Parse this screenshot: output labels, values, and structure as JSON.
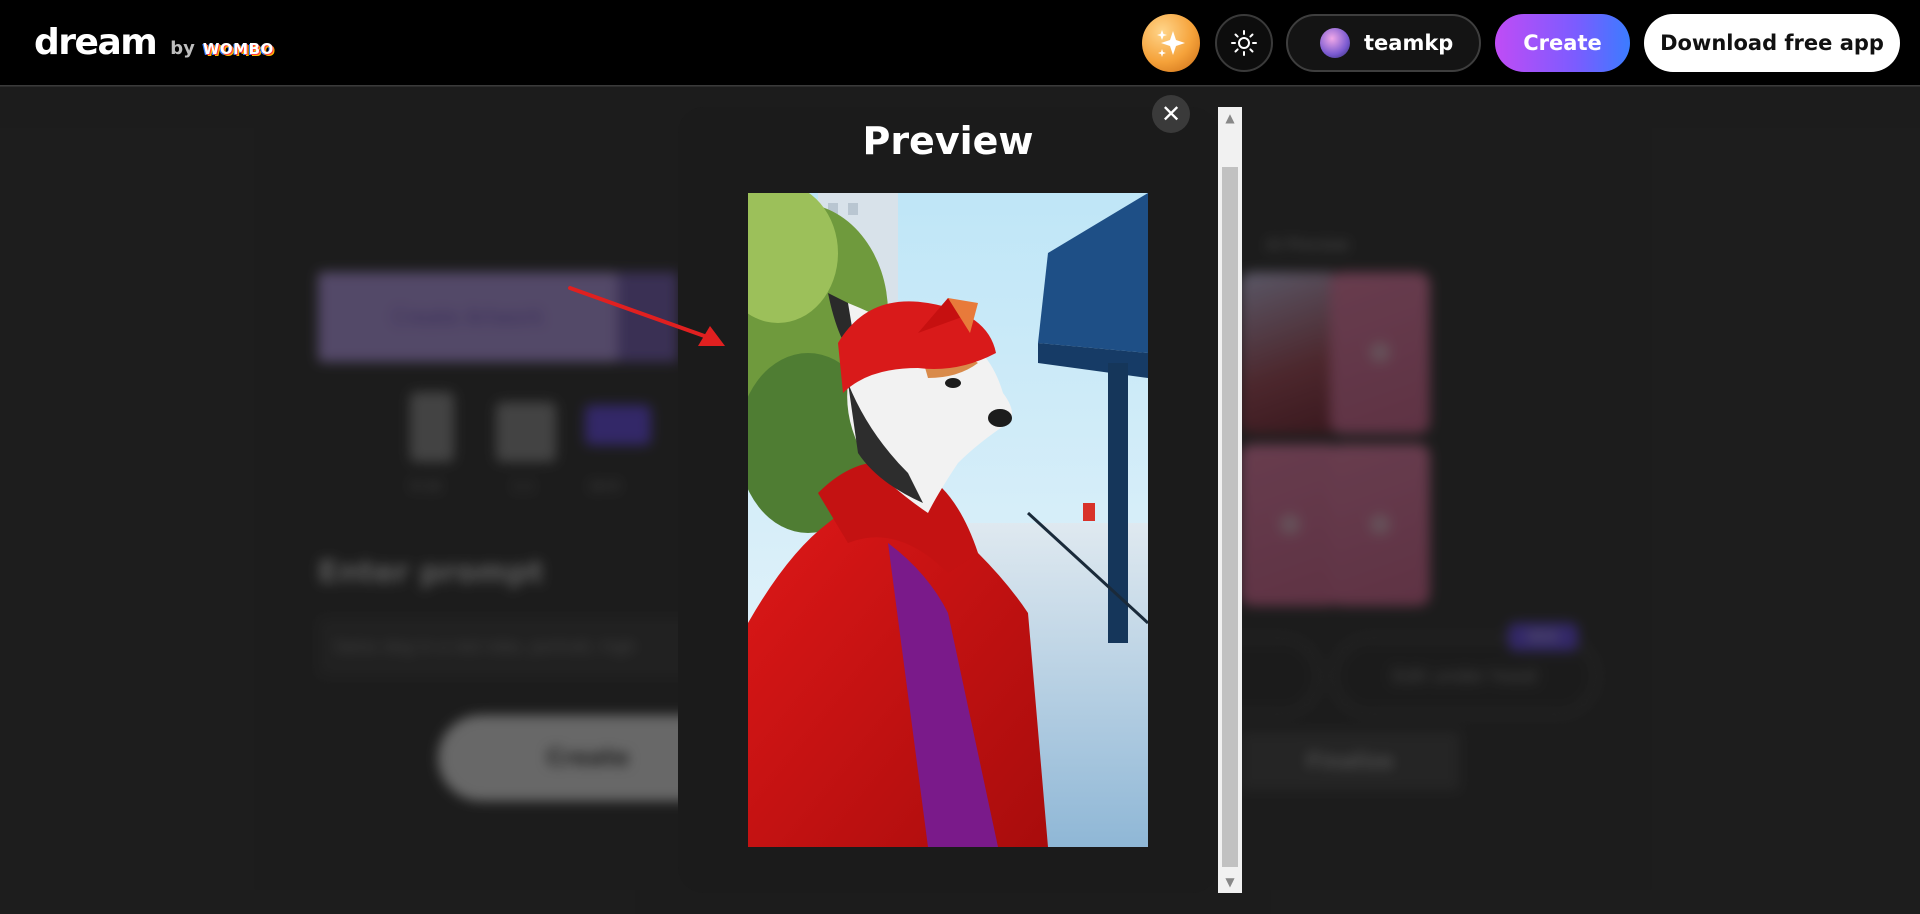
{
  "header": {
    "logo_text": "dream",
    "logo_by": "by",
    "logo_brand": "WOMBO",
    "user_name": "teamkp",
    "create_label": "Create",
    "download_label": "Download free app"
  },
  "modal": {
    "title": "Preview",
    "close_glyph": "✕"
  },
  "background": {
    "tab_active_label": "Create Artwork",
    "ratio_labels": [
      "9:16",
      "1:1",
      "16:9"
    ],
    "prompt_heading": "Enter prompt",
    "prompt_value": "Swiss dog in a red robe, portrait, high",
    "create_label": "Create",
    "ai_preview_label": "AI Preview",
    "edit_label": "Edit under hood",
    "new_badge": "NEW",
    "finalize_label": "Finalize"
  },
  "colors": {
    "create_gradient_start": "#c04cf5",
    "create_gradient_end": "#3b7cff",
    "annotation_arrow": "#e02020",
    "modal_bg": "#1b1b1b"
  },
  "icons": {
    "sparkle": "sparkle-icon",
    "theme": "sun-icon",
    "close": "close-icon"
  }
}
